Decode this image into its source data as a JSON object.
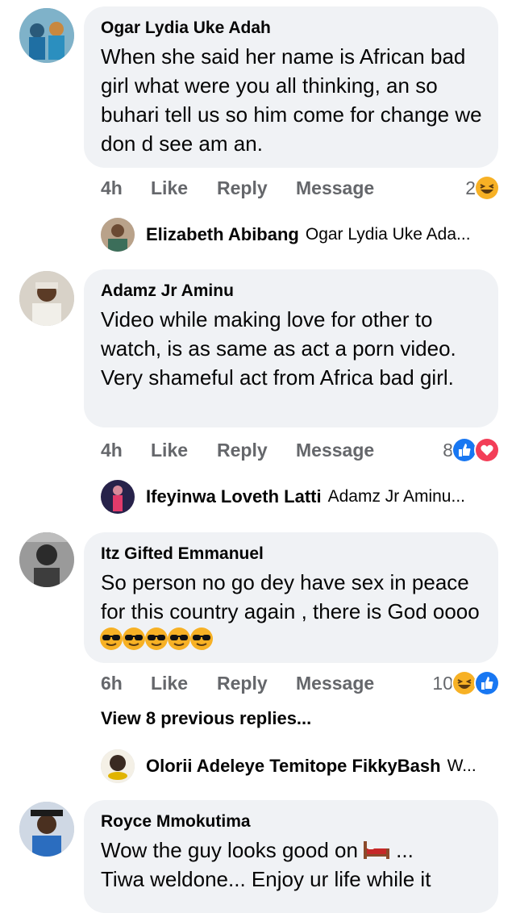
{
  "comments": [
    {
      "author": "Ogar Lydia Uke Adah",
      "text": "When she said her name is African bad girl what were you all thinking, an so buhari tell us so him come for change we don d see am an.",
      "time": "4h",
      "like": "Like",
      "reply": "Reply",
      "message": "Message",
      "reaction_count": "2",
      "reactions": [
        "haha"
      ]
    },
    {
      "author": "Adamz Jr Aminu",
      "text": "Video while making love for other to watch, is as same as act a porn video. Very shameful act from Africa bad girl.",
      "time": "4h",
      "like": "Like",
      "reply": "Reply",
      "message": "Message",
      "reaction_count": "8",
      "reactions": [
        "like",
        "love"
      ]
    },
    {
      "author": "Itz Gifted Emmanuel",
      "text": "So person no go dey have sex in peace for this country again , there is God oooo",
      "time": "6h",
      "like": "Like",
      "reply": "Reply",
      "message": "Message",
      "reaction_count": "10",
      "reactions": [
        "haha",
        "like"
      ],
      "emojis": [
        "sunglasses-emoji",
        "sunglasses-emoji",
        "sunglasses-emoji",
        "sunglasses-emoji",
        "sunglasses-emoji"
      ]
    },
    {
      "author": "Royce Mmokutima",
      "text_1": "Wow the guy looks good on",
      "text_1_end": " ...",
      "text_2": "Tiwa weldone... Enjoy ur life while it",
      "emoji": "bed-emoji"
    }
  ],
  "replies": [
    {
      "name": "Elizabeth Abibang",
      "preview": "Ogar Lydia Uke Ada..."
    },
    {
      "name": "Ifeyinwa Loveth Latti",
      "preview": "Adamz Jr Aminu..."
    },
    {
      "name": "Olorii Adeleye Temitope FikkyBash",
      "preview": "W..."
    }
  ],
  "view_previous": "View 8 previous replies...",
  "colors": {
    "bubble": "#f0f2f5",
    "meta": "#65676b",
    "like_blue": "#1877f2",
    "love_red": "#f33e58",
    "haha_yellow": "#f7b125"
  }
}
